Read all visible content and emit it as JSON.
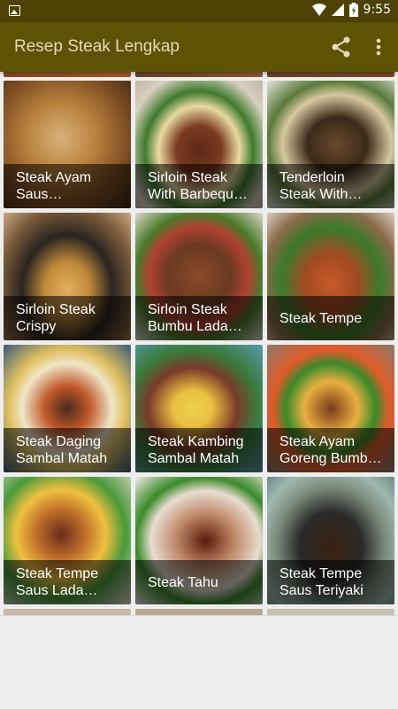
{
  "status_bar": {
    "time": "9:55"
  },
  "app_bar": {
    "title": "Resep Steak Lengkap",
    "actions": [
      "share-icon",
      "more-vert-icon"
    ]
  },
  "recipes": [
    {
      "line1": "Steak Ayam",
      "line2": "Saus…"
    },
    {
      "line1": "Sirloin Steak",
      "line2": "With Barbequ…"
    },
    {
      "line1": "Tenderloin",
      "line2": "Steak With…"
    },
    {
      "line1": "Sirloin Steak",
      "line2": "Crispy"
    },
    {
      "line1": "Sirloin Steak",
      "line2": "Bumbu Lada…"
    },
    {
      "line1": "Steak Tempe",
      "line2": ""
    },
    {
      "line1": "Steak Daging",
      "line2": "Sambal Matah"
    },
    {
      "line1": "Steak Kambing",
      "line2": "Sambal Matah"
    },
    {
      "line1": "Steak Ayam",
      "line2": "Goreng Bumb…"
    },
    {
      "line1": "Steak Tempe",
      "line2": "Saus Lada…"
    },
    {
      "line1": "Steak Tahu",
      "line2": ""
    },
    {
      "line1": "Steak Tempe",
      "line2": "Saus Teriyaki"
    }
  ],
  "colors": {
    "status_bar": "#4d4203",
    "app_bar": "#5e5205",
    "title_text": "#e6dcb8"
  }
}
